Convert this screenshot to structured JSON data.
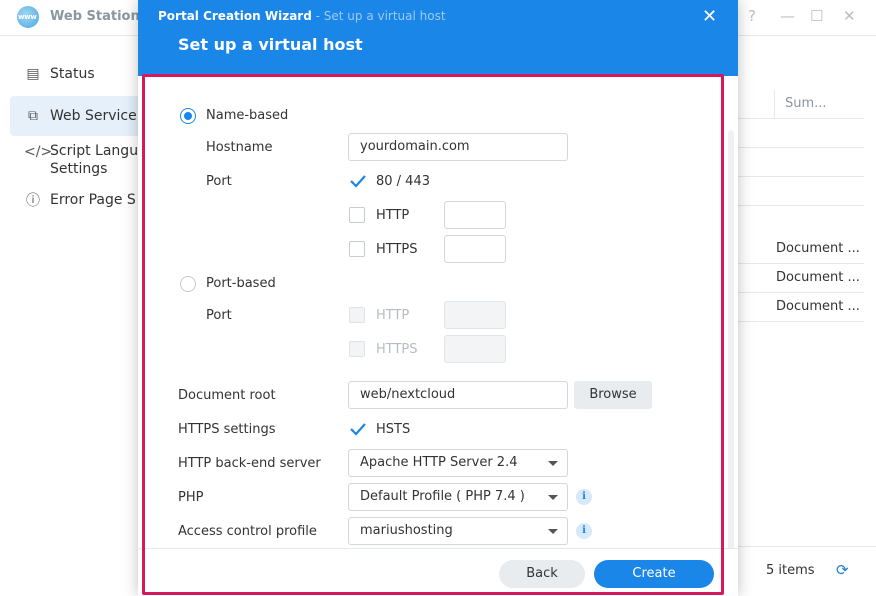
{
  "app": {
    "title": "Web Station",
    "logo_text": "www",
    "window_controls": [
      "?",
      "—",
      "☐",
      "✕"
    ]
  },
  "sidebar": {
    "items": [
      {
        "label": "Status",
        "icon": "status-icon"
      },
      {
        "label": "Web Service",
        "icon": "web-service-icon",
        "active": true
      },
      {
        "label": "Script Language Settings",
        "line1": "Script Langu",
        "line2": "Settings",
        "icon": "code-icon"
      },
      {
        "label": "Error Page S",
        "icon": "error-page-icon"
      }
    ]
  },
  "table": {
    "column_header": "Sum...",
    "rows": [
      "Document ...",
      "Document ...",
      "Document ..."
    ],
    "items_count": "5 items"
  },
  "dialog": {
    "wizard_name": "Portal Creation Wizard",
    "step_crumb": " - Set up a virtual host",
    "title": "Set up a virtual host",
    "name_based": {
      "label": "Name-based",
      "selected": true,
      "hostname_label": "Hostname",
      "hostname_value": "yourdomain.com",
      "port_label": "Port",
      "port_default_label": "80 / 443",
      "port_default_checked": true,
      "http_label": "HTTP",
      "https_label": "HTTPS"
    },
    "port_based": {
      "label": "Port-based",
      "selected": false,
      "port_label": "Port",
      "http_label": "HTTP",
      "https_label": "HTTPS"
    },
    "document_root": {
      "label": "Document root",
      "value": "web/nextcloud",
      "browse_label": "Browse"
    },
    "https_settings": {
      "label": "HTTPS settings",
      "hsts_label": "HSTS",
      "hsts_checked": true
    },
    "backend": {
      "label": "HTTP back-end server",
      "value": "Apache HTTP Server 2.4"
    },
    "php": {
      "label": "PHP",
      "value": "Default Profile ( PHP 7.4 )"
    },
    "access_control": {
      "label": "Access control profile",
      "value": "mariushosting"
    },
    "buttons": {
      "back": "Back",
      "create": "Create"
    }
  },
  "colors": {
    "primary": "#1a86e8",
    "highlight": "#d6185c"
  }
}
